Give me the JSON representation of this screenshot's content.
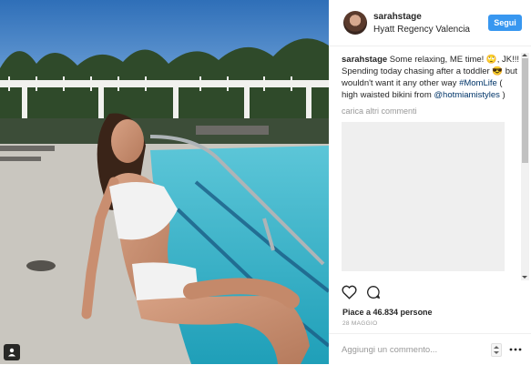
{
  "post": {
    "username": "sarahstage",
    "location": "Hyatt Regency Valencia",
    "follow_label": "Segui",
    "caption": {
      "user": "sarahstage",
      "text_before": " Some relaxing, ME time! 🙄, JK!!! Spending today chasing after a toddler 😎 but wouldn't want it any other way ",
      "hashtag": "#MomLife",
      "text_middle": " ( high waisted bikini from ",
      "mention": "@hotmiamistyles",
      "text_after": " )"
    },
    "load_more_label": "carica altri commenti",
    "embed_placeholder": "",
    "likes_text": "Piace a 46.834 persone",
    "date_text": "28 MAGGIO",
    "comment_placeholder": "Aggiungi un commento...",
    "icons": {
      "like": "heart-icon",
      "comment": "speech-bubble-icon",
      "tag": "user-tag-icon",
      "more": "more-options-icon"
    },
    "colors": {
      "follow_button": "#3897f0",
      "link": "#003569",
      "secondary_text": "#999999"
    }
  }
}
